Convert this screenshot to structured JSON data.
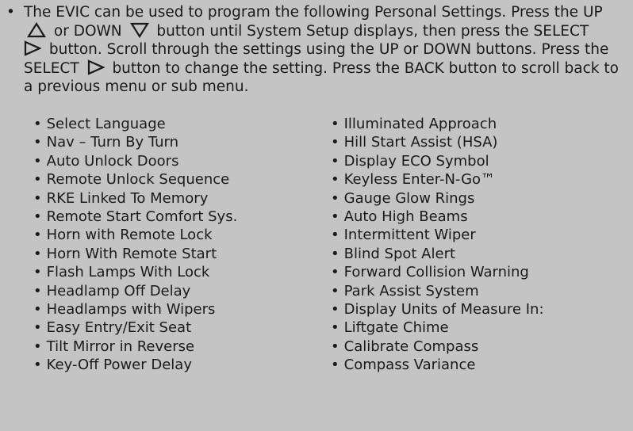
{
  "intro": {
    "bullet": "•",
    "seg1": "The EVIC can be used to program the following Personal Settings. Press the UP",
    "seg2": "or DOWN",
    "seg3": "button until System Setup displays, then press the SELECT",
    "seg4": "button. Scroll through the settings using the UP or DOWN buttons. Press the SELECT",
    "seg5": "button to change the setting. Press the BACK button to scroll back to a previous menu or sub menu.",
    "icons": [
      "up-triangle-icon",
      "down-triangle-icon",
      "select-arrow-icon",
      "select-arrow-icon"
    ]
  },
  "left_items": [
    "Select Language",
    "Nav – Turn By Turn",
    "Auto Unlock Doors",
    "Remote Unlock Sequence",
    "RKE Linked To Memory",
    "Remote Start Comfort Sys.",
    "Horn with Remote Lock",
    "Horn With Remote Start",
    "Flash Lamps With Lock",
    "Headlamp Off Delay",
    "Headlamps with Wipers",
    "Easy Entry/Exit Seat",
    "Tilt Mirror in Reverse",
    "Key-Off Power Delay"
  ],
  "right_items": [
    "Illuminated Approach",
    "Hill Start Assist (HSA)",
    "Display ECO Symbol",
    "Keyless Enter-N-Go™",
    "Gauge Glow Rings",
    "Auto High Beams",
    "Intermittent Wiper",
    "Blind Spot Alert",
    "Forward Collision Warning",
    "Park Assist System",
    "Display Units of Measure In:",
    "Liftgate Chime",
    "Calibrate Compass",
    "Compass Variance"
  ],
  "colors": {
    "background": "#c4c4c4",
    "text": "#1a1a1a"
  }
}
